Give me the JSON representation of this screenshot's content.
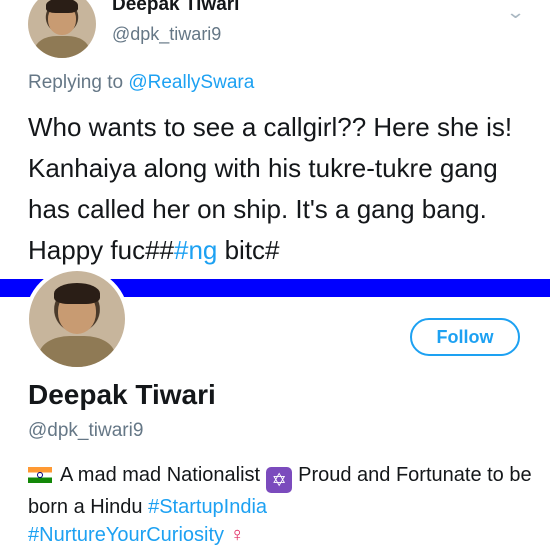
{
  "tweet": {
    "name": "Deepak Tiwari",
    "handle": "@dpk_tiwari9",
    "replying_prefix": "Replying to ",
    "replying_to": "@ReallySwara",
    "text_part1": "Who wants to see a callgirl?? Here she is! Kanhaiya along with his tukre-tukre gang has called her on ship. It's a gang bang.  Happy fuc##",
    "text_hashtag": "#ng",
    "text_part2": " bitc#",
    "menu_icon": "chevron-down-icon"
  },
  "profile": {
    "follow_label": "Follow",
    "name": "Deepak Tiwari",
    "handle": "@dpk_tiwari9",
    "bio_part1": "A mad mad Nationalist",
    "bio_part2": "Proud and Fortunate to be born a Hindu ",
    "hashtag1": "#StartupIndia",
    "hashtag2": "#NurtureYourCuriosity",
    "icons": [
      "india-flag-icon",
      "star-of-david-icon",
      "venus-symbol-icon"
    ]
  },
  "colors": {
    "accent": "#1da1f2",
    "divider_bar": "#0000ff",
    "secondary_text": "#657786"
  }
}
